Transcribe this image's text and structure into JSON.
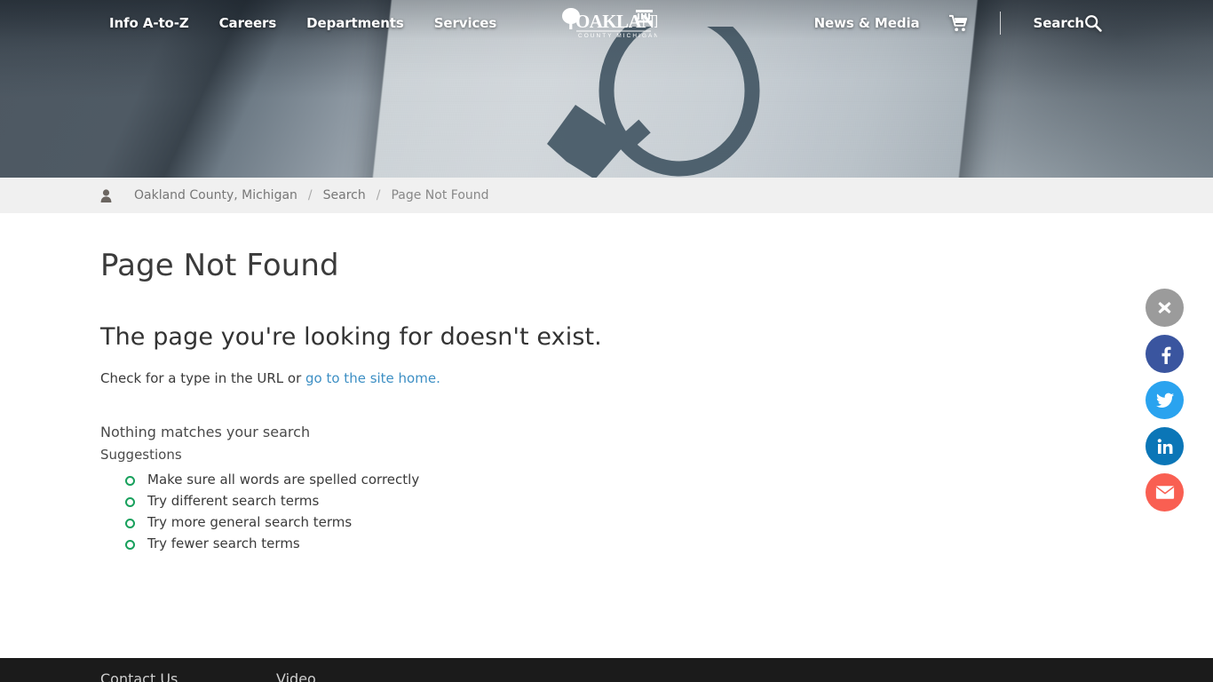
{
  "nav": {
    "left_items": [
      {
        "label": "Info A-to-Z",
        "name": "nav-info-a-to-z"
      },
      {
        "label": "Careers",
        "name": "nav-careers"
      },
      {
        "label": "Departments",
        "name": "nav-departments"
      },
      {
        "label": "Services",
        "name": "nav-services"
      }
    ],
    "logo": {
      "primary": "OAKLAND",
      "secondary": "COUNTY MICHIGAN",
      "icon": "oakland-county-logo"
    },
    "news_media": "News & Media",
    "cart_icon": "shopping-cart-icon",
    "search_label": "Search",
    "search_icon": "search-icon"
  },
  "breadcrumb": {
    "user_icon": "user-icon",
    "items": [
      {
        "label": "Oakland County, Michigan",
        "name": "breadcrumb-home"
      },
      {
        "label": "Search",
        "name": "breadcrumb-search"
      },
      {
        "label": "Page Not Found",
        "name": "breadcrumb-current"
      }
    ],
    "separator": "/"
  },
  "main": {
    "page_title": "Page Not Found",
    "sub_heading": "The page you're looking for doesn't exist.",
    "check_text_before": "Check for a type in the URL or ",
    "check_link": "go to the site home.",
    "no_match": "Nothing matches your search",
    "suggestions_label": "Suggestions",
    "suggestions": [
      "Make sure all words are spelled correctly",
      "Try different search terms",
      "Try more general search terms",
      "Try fewer search terms"
    ]
  },
  "social": {
    "buttons": [
      {
        "name": "close-share-button",
        "icon": "close-icon",
        "color": "#9b9b9b",
        "label": "Close"
      },
      {
        "name": "facebook-share-button",
        "icon": "facebook-icon",
        "color": "#3a559f",
        "label": "Facebook"
      },
      {
        "name": "twitter-share-button",
        "icon": "twitter-icon",
        "color": "#2aa3ef",
        "label": "Twitter"
      },
      {
        "name": "linkedin-share-button",
        "icon": "linkedin-icon",
        "color": "#0b76b7",
        "label": "LinkedIn"
      },
      {
        "name": "email-share-button",
        "icon": "email-icon",
        "color": "#f95f52",
        "label": "Email"
      }
    ]
  },
  "footer": {
    "columns": [
      {
        "label": "Contact Us",
        "name": "footer-contact-us"
      },
      {
        "label": "Video",
        "name": "footer-video"
      }
    ]
  },
  "theme": {
    "link_color": "#3d8fc4",
    "bullet_color": "#18a05c",
    "breadcrumb_bg": "#f0f0f0",
    "footer_bg": "#1b1b1b"
  }
}
